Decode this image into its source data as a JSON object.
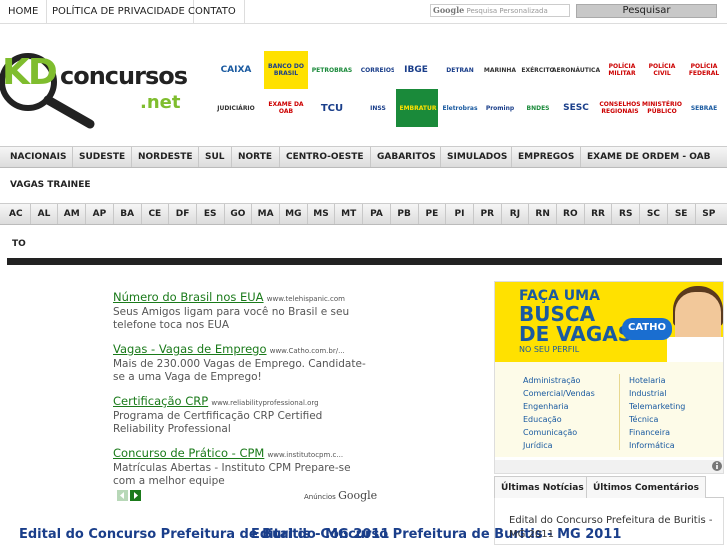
{
  "topnav": {
    "items": [
      "HOME",
      "POLÍTICA DE PRIVACIDADE",
      "CONTATO"
    ],
    "search_brand": "Google",
    "search_placeholder": "Pesquisa Personalizada",
    "search_button": "Pesquisar"
  },
  "logo": {
    "kd": "KD",
    "concursos": "concursos",
    "net": ".net"
  },
  "partner_logos": [
    "CAIXA",
    "BANCO DO BRASIL",
    "PETROBRAS",
    "CORREIOS",
    "IBGE",
    "DETRAN",
    "MARINHA",
    "EXÉRCITO",
    "AERONÁUTICA",
    "POLÍCIA MILITAR",
    "POLÍCIA CIVIL",
    "POLÍCIA FEDERAL",
    "JUDICIÁRIO",
    "EXAME DA OAB",
    "TCU",
    "INSS",
    "EMBRATUR",
    "Eletrobras",
    "Prominp",
    "BNDES",
    "SESC",
    "CONSELHOS REGIONAIS",
    "MINISTÉRIO PÚBLICO",
    "SEBRAE"
  ],
  "mainnav": [
    "NACIONAIS",
    "SUDESTE",
    "NORDESTE",
    "SUL",
    "NORTE",
    "CENTRO-OESTE",
    "GABARITOS",
    "SIMULADOS",
    "EMPREGOS",
    "EXAME DE ORDEM - OAB"
  ],
  "trainee": "VAGAS TRAINEE",
  "states": [
    "AC",
    "AL",
    "AM",
    "AP",
    "BA",
    "CE",
    "DF",
    "ES",
    "GO",
    "MA",
    "MG",
    "MS",
    "MT",
    "PA",
    "PB",
    "PE",
    "PI",
    "PR",
    "RJ",
    "RN",
    "RO",
    "RR",
    "RS",
    "SC",
    "SE",
    "SP"
  ],
  "state_last": "TO",
  "ads": [
    {
      "title": "Número do Brasil nos EUA",
      "url": "www.telehispanic.com",
      "desc": "Seus Amigos ligam para você no Brasil e seu telefone toca nos EUA"
    },
    {
      "title": "Vagas - Vagas de Emprego",
      "url": "www.Catho.com.br/...",
      "desc": "Mais de 230.000 Vagas de Emprego. Candidate-se a uma Vaga de Emprego!"
    },
    {
      "title": "Certificação CRP",
      "url": "www.reliabilityprofessional.org",
      "desc": "Programa de Certfificação CRP Certified Reliability Professional"
    },
    {
      "title": "Concurso de Prático - CPM",
      "url": "www.institutocpm.c...",
      "desc": "Matrículas Abertas - Instituto CPM Prepare-se com a melhor equipe"
    }
  ],
  "ads_by": {
    "label": "Anúncios",
    "brand": "Google"
  },
  "posts": [
    "Edital do Concurso Prefeitura de Buritis - MG 2011",
    "Edital do Concurso Prefeitura de Buritis - MG 2011"
  ],
  "banner": {
    "line1": "FAÇA UMA",
    "line2": "BUSCA",
    "line3": "DE VAGAS",
    "line4": "NO SEU PERFIL",
    "brand": "CATHO",
    "col1": [
      "Administração",
      "Comercial/Vendas",
      "Engenharia",
      "Educação",
      "Comunicação",
      "Jurídica"
    ],
    "col2": [
      "Hotelaria",
      "Industrial",
      "Telemarketing",
      "Técnica",
      "Financeira",
      "Informática"
    ]
  },
  "tabs": [
    "Últimas Notícias",
    "Últimos Comentários"
  ],
  "sidebar_item": "Edital do Concurso Prefeitura de Buritis - MG 2011",
  "colors": {
    "green": "#7fbd2e",
    "ad_green": "#1a7a1a",
    "title_blue": "#1a3e8a",
    "catho_yellow": "#ffe100"
  }
}
